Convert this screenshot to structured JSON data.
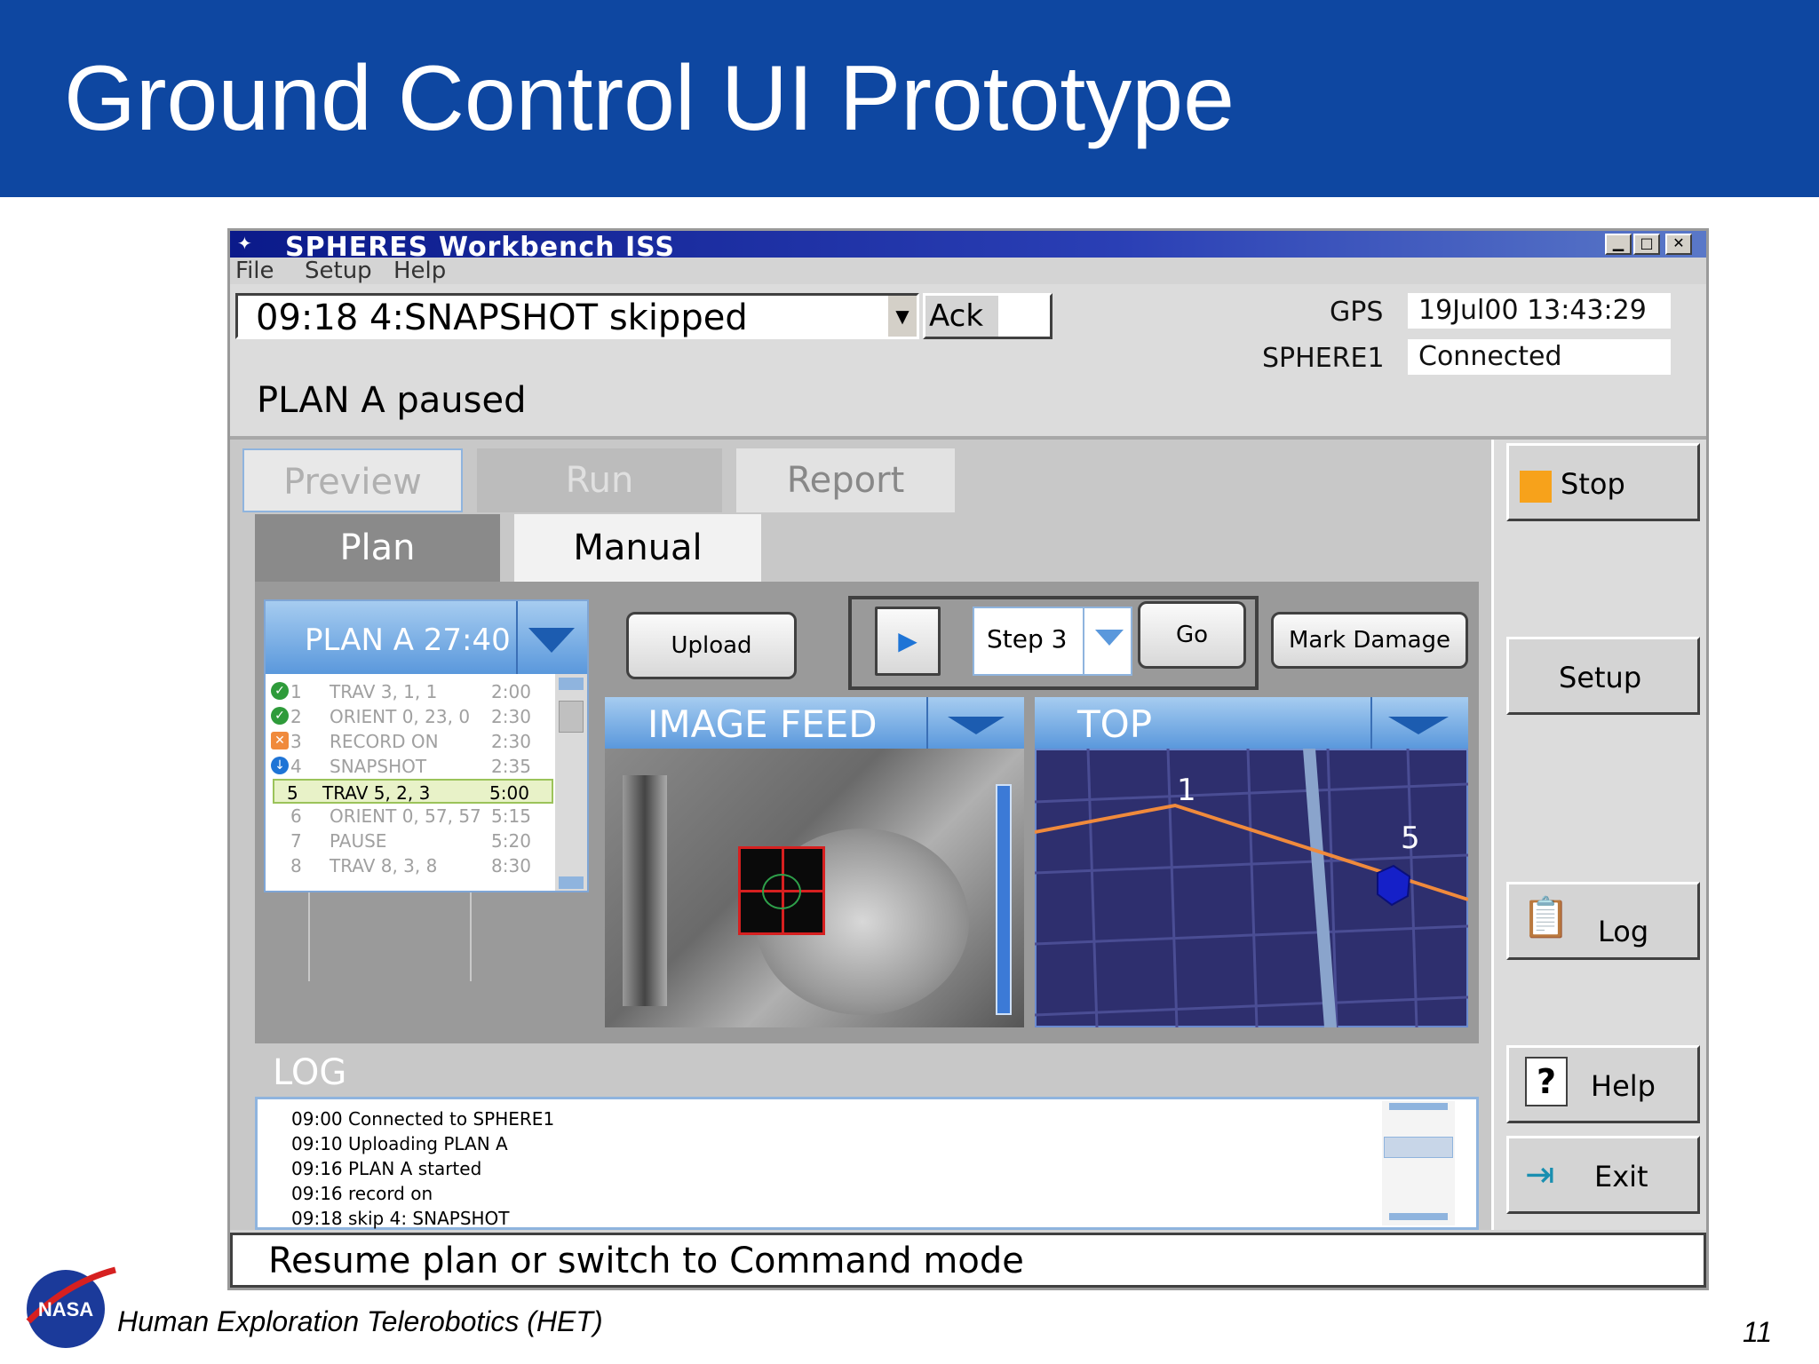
{
  "slide": {
    "title": "Ground Control UI Prototype",
    "footer": "Human Exploration Telerobotics (HET)",
    "page_number": "11",
    "logo_text": "NASA",
    "header_color": "#0e47a1"
  },
  "window": {
    "title": "SPHERES Workbench ISS",
    "controls": [
      "minimize-icon",
      "maximize-icon",
      "close-icon"
    ]
  },
  "menu": {
    "items": [
      "File",
      "Setup",
      "Help"
    ]
  },
  "status": {
    "message": "09:18 4:SNAPSHOT skipped",
    "ack_label": "Ack",
    "plan_status": "PLAN A paused",
    "gps_label": "GPS",
    "gps_value": "19Jul00  13:43:29",
    "sphere_label": "SPHERE1",
    "sphere_value": "Connected"
  },
  "tabs": {
    "top": [
      "Preview",
      "Run",
      "Report"
    ],
    "sub": [
      "Plan",
      "Manual"
    ]
  },
  "plan": {
    "name": "PLAN A  27:40",
    "rows": [
      {
        "idx": "1",
        "cmd": "TRAV 3, 1, 1",
        "dur": "2:00",
        "status": "done"
      },
      {
        "idx": "2",
        "cmd": "ORIENT 0, 23, 0",
        "dur": "2:30",
        "status": "done"
      },
      {
        "idx": "3",
        "cmd": "RECORD ON",
        "dur": "2:30",
        "status": "warning"
      },
      {
        "idx": "4",
        "cmd": "SNAPSHOT",
        "dur": "2:35",
        "status": "skipped"
      },
      {
        "idx": "5",
        "cmd": "TRAV 5, 2, 3",
        "dur": "5:00",
        "status": "current"
      },
      {
        "idx": "6",
        "cmd": "ORIENT 0, 57, 57",
        "dur": "5:15",
        "status": "pending"
      },
      {
        "idx": "7",
        "cmd": "PAUSE",
        "dur": "5:20",
        "status": "pending"
      },
      {
        "idx": "8",
        "cmd": "TRAV 8, 3, 8",
        "dur": "8:30",
        "status": "pending"
      }
    ]
  },
  "controls": {
    "upload": "Upload",
    "step": "Step 3",
    "go": "Go",
    "mark_damage": "Mark Damage"
  },
  "views": {
    "image_feed": "IMAGE FEED",
    "top": "TOP",
    "markers": [
      "1",
      "5"
    ]
  },
  "log": {
    "title": "LOG",
    "lines": [
      "09:00 Connected to SPHERE1",
      "09:10 Uploading PLAN A",
      "09:16 PLAN A started",
      "09:16 record on",
      "09:18 skip 4: SNAPSHOT"
    ]
  },
  "side": {
    "stop": "Stop",
    "setup": "Setup",
    "log": "Log",
    "help": "Help",
    "exit": "Exit"
  },
  "command_line": "Resume plan or switch to Command mode",
  "colors": {
    "accent_blue": "#5a98dc",
    "stop_orange": "#f7a21b",
    "path_orange": "#f08a3c",
    "map_bg": "#2e2f6e"
  }
}
